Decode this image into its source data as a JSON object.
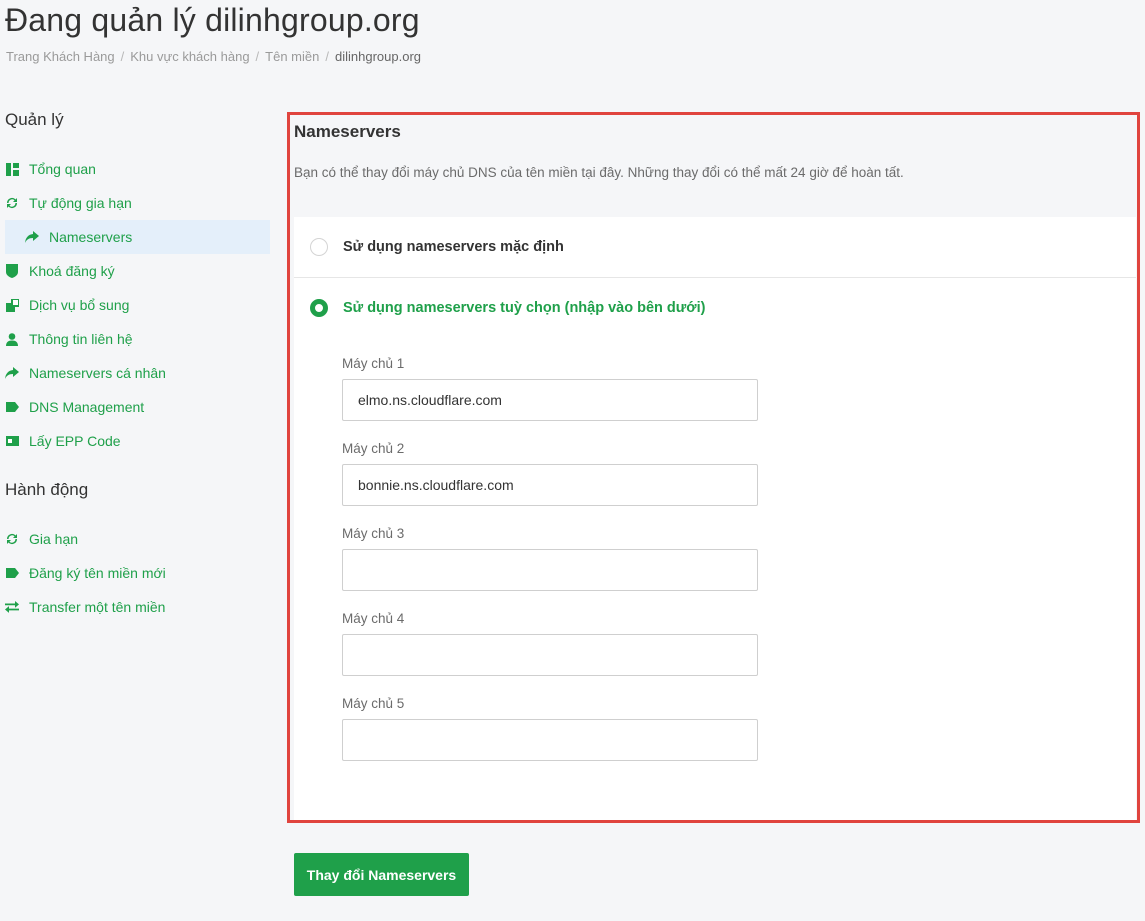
{
  "page": {
    "title": "Đang quản lý dilinhgroup.org"
  },
  "breadcrumb": {
    "items": [
      "Trang Khách Hàng",
      "Khu vực khách hàng",
      "Tên miền"
    ],
    "separator": "/",
    "current": "dilinhgroup.org"
  },
  "sidebar": {
    "manage_heading": "Quản lý",
    "manage_items": [
      {
        "label": "Tổng quan",
        "icon": "dashboard-icon"
      },
      {
        "label": "Tự động gia hạn",
        "icon": "refresh-icon"
      },
      {
        "label": "Nameservers",
        "icon": "share-arrow-icon",
        "active": true
      },
      {
        "label": "Khoá đăng ký",
        "icon": "shield-icon"
      },
      {
        "label": "Dịch vụ bổ sung",
        "icon": "addon-icon"
      },
      {
        "label": "Thông tin liên hệ",
        "icon": "user-icon"
      },
      {
        "label": "Nameservers cá nhân",
        "icon": "share-arrow-icon"
      },
      {
        "label": "DNS Management",
        "icon": "tag-icon"
      },
      {
        "label": "Lấy EPP Code",
        "icon": "id-card-icon"
      }
    ],
    "actions_heading": "Hành động",
    "action_items": [
      {
        "label": "Gia hạn",
        "icon": "refresh-icon"
      },
      {
        "label": "Đăng ký tên miền mới",
        "icon": "tag-icon"
      },
      {
        "label": "Transfer một tên miền",
        "icon": "exchange-icon"
      }
    ]
  },
  "nameservers": {
    "title": "Nameservers",
    "description": "Bạn có thể thay đổi máy chủ DNS của tên miền tại đây. Những thay đổi có thể mất 24 giờ để hoàn tất.",
    "option_default": "Sử dụng nameservers mặc định",
    "option_custom": "Sử dụng nameservers tuỳ chọn (nhập vào bên dưới)",
    "selected": "custom",
    "fields": [
      {
        "label": "Máy chủ 1",
        "value": "elmo.ns.cloudflare.com"
      },
      {
        "label": "Máy chủ 2",
        "value": "bonnie.ns.cloudflare.com"
      },
      {
        "label": "Máy chủ 3",
        "value": ""
      },
      {
        "label": "Máy chủ 4",
        "value": ""
      },
      {
        "label": "Máy chủ 5",
        "value": ""
      }
    ],
    "submit_label": "Thay đổi Nameservers"
  },
  "colors": {
    "accent": "#1fa04a",
    "highlight_border": "#e0443e",
    "active_item_bg": "#e4effa",
    "page_bg": "#f5f6f8"
  }
}
